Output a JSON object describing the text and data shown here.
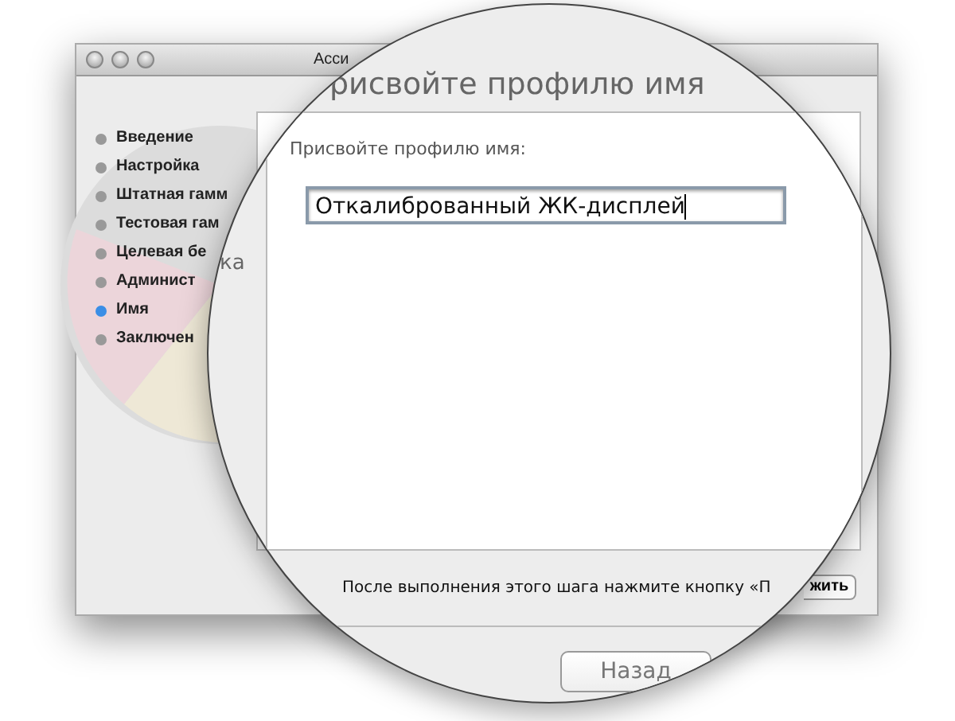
{
  "window": {
    "title": "Асси"
  },
  "sidebar": {
    "items": [
      {
        "label": "Введение",
        "selected": false
      },
      {
        "label": "Настройка",
        "selected": false
      },
      {
        "label": "Штатная гамм",
        "selected": false
      },
      {
        "label": "Тестовая гам",
        "selected": false
      },
      {
        "label": "Целевая бе",
        "selected": false
      },
      {
        "label": "Админист",
        "selected": false
      },
      {
        "label": "Имя",
        "selected": true
      },
      {
        "label": "Заключен",
        "selected": false
      }
    ]
  },
  "stray_text": "ка",
  "continue_button": {
    "label": "жить"
  },
  "magnifier": {
    "title": "рисвойте профилю имя",
    "field_label": "Присвойте профилю имя:",
    "field": {
      "value": "Откалиброванный ЖК-дисплей"
    },
    "instruction": "После выполнения этого шага нажмите кнопку «П",
    "back_button": {
      "label": "Назад"
    }
  }
}
